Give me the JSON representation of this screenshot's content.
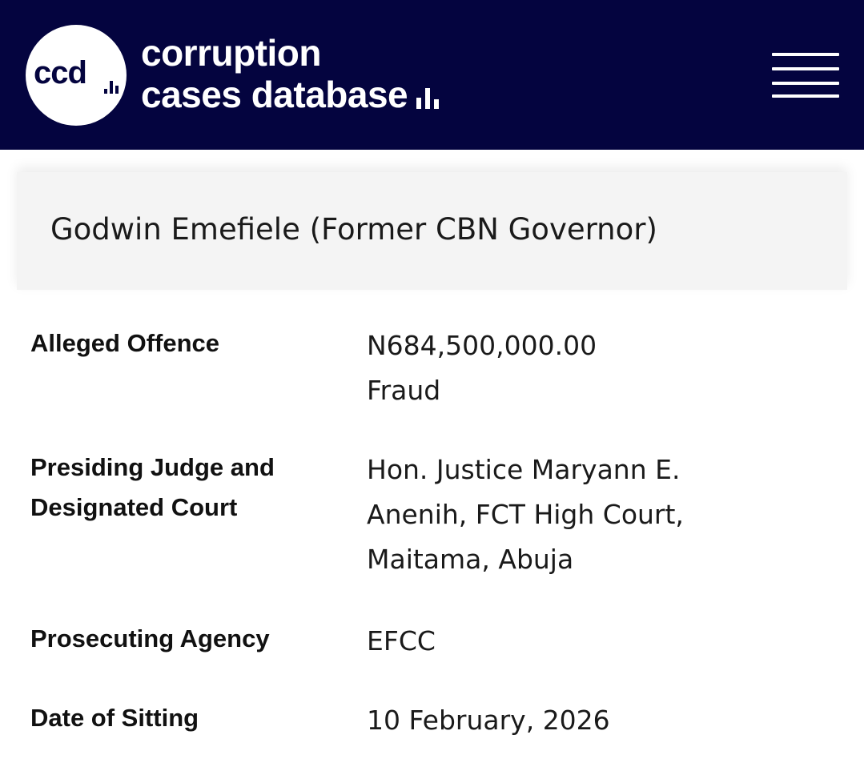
{
  "header": {
    "logo_text": "ccd",
    "brand_line1": "corruption",
    "brand_line2": "cases database",
    "menu_icon": "hamburger-menu-icon",
    "background_color": "#04043f"
  },
  "case": {
    "title": "Godwin Emefiele (Former CBN Governor)"
  },
  "details": {
    "alleged_offence": {
      "label": "Alleged Offence",
      "amount": "N684,500,000.00",
      "type": "Fraud"
    },
    "judge_court": {
      "label_line1": "Presiding Judge and",
      "label_line2": "Designated Court",
      "value_line1": "Hon. Justice Maryann E.",
      "value_line2": "Anenih, FCT High Court,",
      "value_line3": "Maitama, Abuja"
    },
    "prosecuting_agency": {
      "label": "Prosecuting Agency",
      "value": "EFCC"
    },
    "date_of_sitting": {
      "label": "Date of Sitting",
      "value": "10 February, 2026"
    }
  }
}
